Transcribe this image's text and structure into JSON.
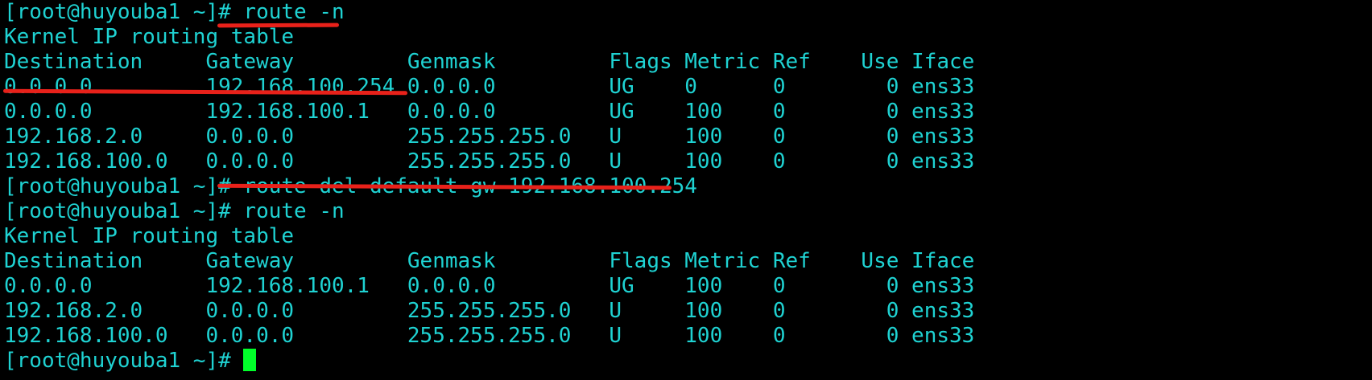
{
  "terminal": {
    "lines": [
      "[root@huyouba1 ~]# route -n",
      "Kernel IP routing table",
      "Destination     Gateway         Genmask         Flags Metric Ref    Use Iface",
      "0.0.0.0         192.168.100.254 0.0.0.0         UG    0      0        0 ens33",
      "0.0.0.0         192.168.100.1   0.0.0.0         UG    100    0        0 ens33",
      "192.168.2.0     0.0.0.0         255.255.255.0   U     100    0        0 ens33",
      "192.168.100.0   0.0.0.0         255.255.255.0   U     100    0        0 ens33",
      "[root@huyouba1 ~]# route del default gw 192.168.100.254",
      "[root@huyouba1 ~]# route -n",
      "Kernel IP routing table",
      "Destination     Gateway         Genmask         Flags Metric Ref    Use Iface",
      "0.0.0.0         192.168.100.1   0.0.0.0         UG    100    0        0 ens33",
      "192.168.2.0     0.0.0.0         255.255.255.0   U     100    0        0 ens33",
      "192.168.100.0   0.0.0.0         255.255.255.0   U     100    0        0 ens33"
    ],
    "prompt": "[root@huyouba1 ~]# ",
    "colors": {
      "background": "#000000",
      "text": "#1fd2d2",
      "cursor": "#00ff2a",
      "annotation": "#e8211a"
    }
  }
}
